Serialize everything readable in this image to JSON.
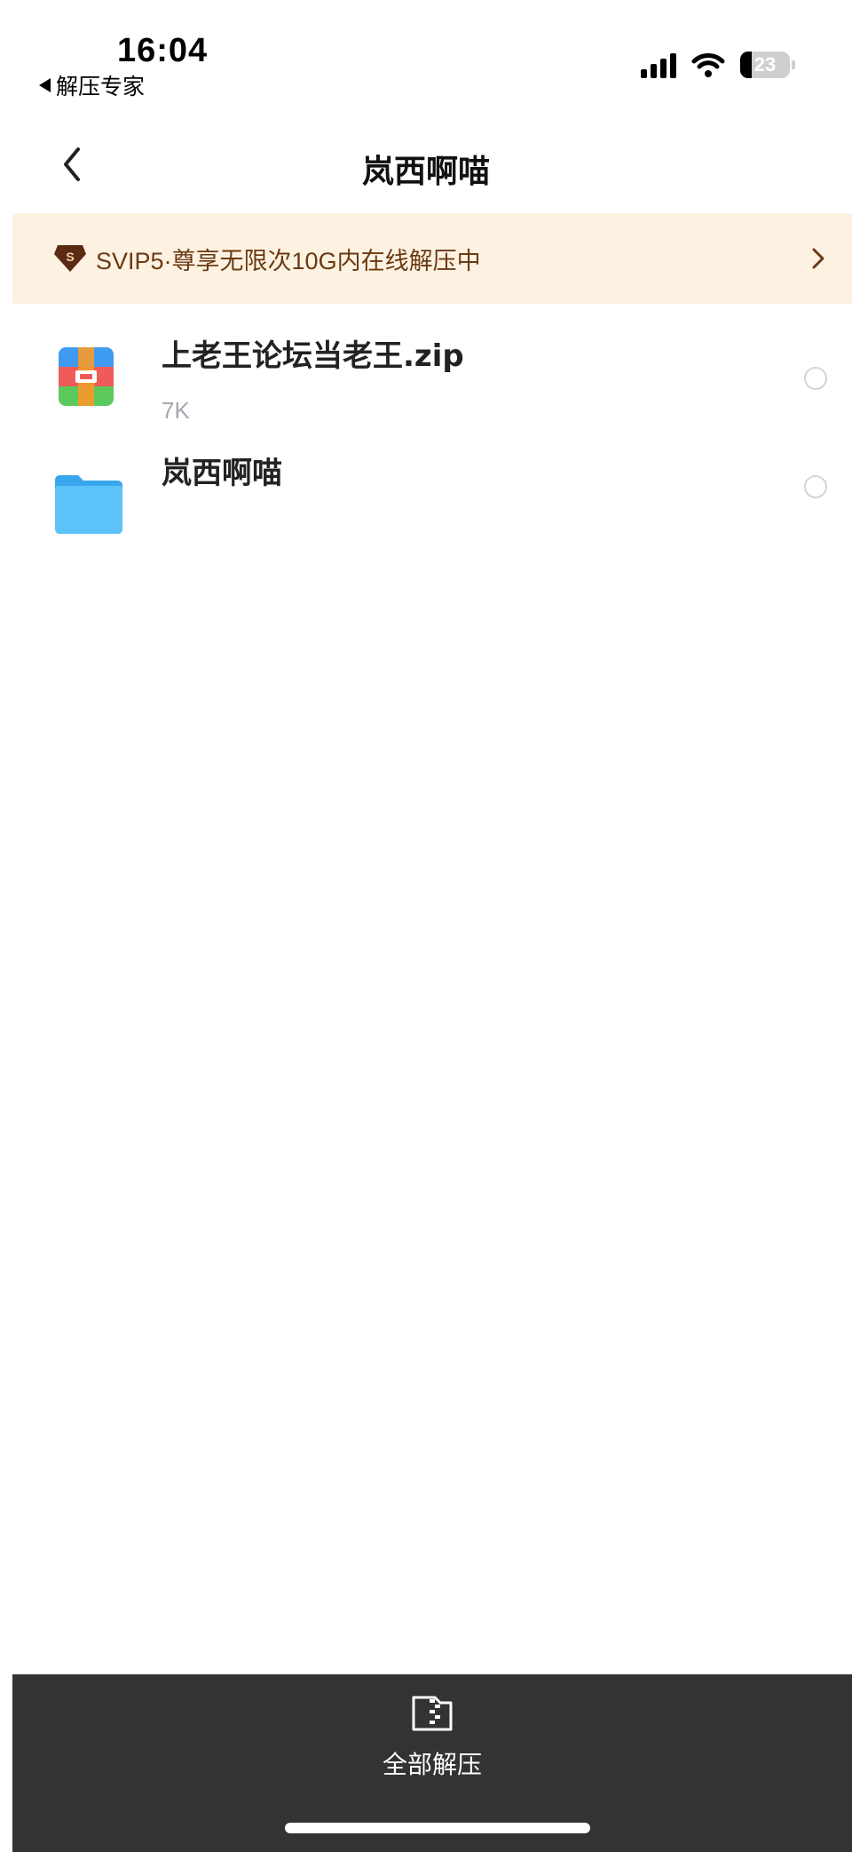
{
  "status_bar": {
    "time": "16:04",
    "back_app": "解压专家",
    "battery": "23",
    "battery_level": 0.23
  },
  "header": {
    "title": "岚西啊喵"
  },
  "vip_banner": {
    "text": "SVIP5·尊享无限次10G内在线解压中",
    "badge_label": "S"
  },
  "files": [
    {
      "name": "上老王论坛当老王.zip",
      "size": "7K",
      "icon": "archive-icon"
    },
    {
      "name": "岚西啊喵",
      "size": "",
      "icon": "folder-icon"
    }
  ],
  "toolbar": {
    "extract_all_label": "全部解压"
  },
  "colors": {
    "banner_bg": "#fdf2e2",
    "banner_text": "#6b3a12",
    "toolbar_bg": "#333333",
    "folder": "#4db8f5"
  }
}
